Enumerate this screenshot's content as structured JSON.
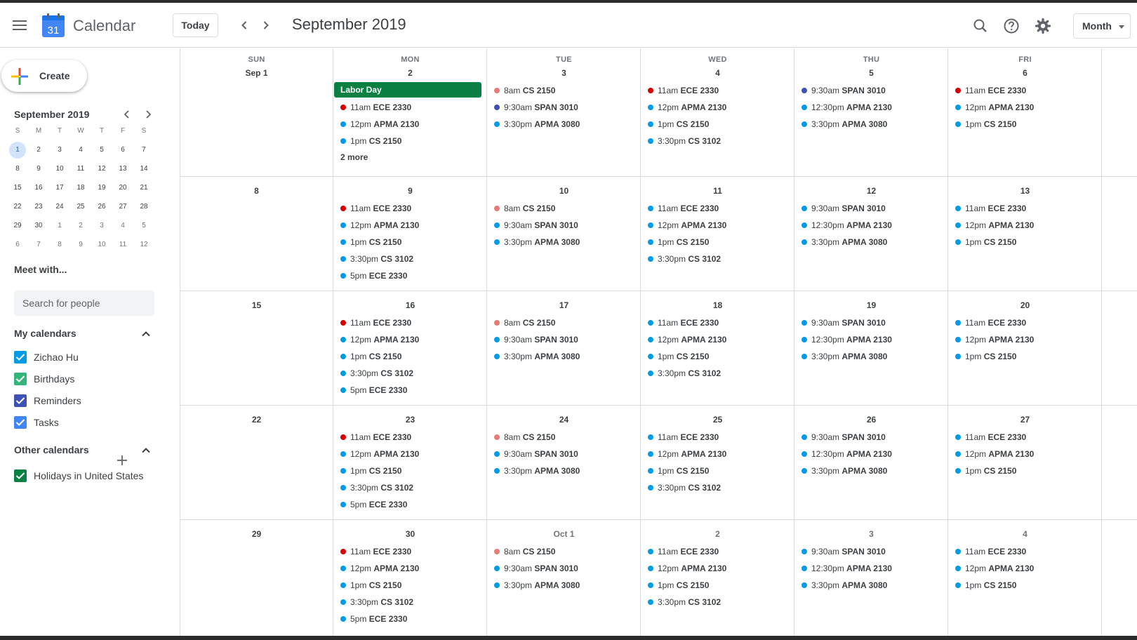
{
  "app": {
    "name": "Calendar",
    "logo_number": "31"
  },
  "header": {
    "today_label": "Today",
    "month_title": "September 2019",
    "view_label": "Month"
  },
  "sidebar": {
    "create_label": "Create",
    "mini_title": "September 2019",
    "mini_dow": [
      "S",
      "M",
      "T",
      "W",
      "T",
      "F",
      "S"
    ],
    "mini_days": [
      [
        "1",
        "2",
        "3",
        "4",
        "5",
        "6",
        "7"
      ],
      [
        "8",
        "9",
        "10",
        "11",
        "12",
        "13",
        "14"
      ],
      [
        "15",
        "16",
        "17",
        "18",
        "19",
        "20",
        "21"
      ],
      [
        "22",
        "23",
        "24",
        "25",
        "26",
        "27",
        "28"
      ],
      [
        "29",
        "30",
        "1",
        "2",
        "3",
        "4",
        "5"
      ],
      [
        "6",
        "7",
        "8",
        "9",
        "10",
        "11",
        "12"
      ]
    ],
    "meet_title": "Meet with...",
    "search_placeholder": "Search for people",
    "my_calendars_title": "My calendars",
    "my_calendars": [
      {
        "name": "Zichao Hu",
        "color": "#039be5"
      },
      {
        "name": "Birthdays",
        "color": "#33b679"
      },
      {
        "name": "Reminders",
        "color": "#3f51b5"
      },
      {
        "name": "Tasks",
        "color": "#4285f4"
      }
    ],
    "other_calendars_title": "Other calendars",
    "other_calendars": [
      {
        "name": "Holidays in United States",
        "color": "#0b8043"
      }
    ]
  },
  "colors": {
    "red": "#d50000",
    "blue": "#039be5",
    "indigo": "#3f51b5",
    "salmon": "#e67c73",
    "green": "#0b8043"
  },
  "month": {
    "dow": [
      "SUN",
      "MON",
      "TUE",
      "WED",
      "THU",
      "FRI"
    ],
    "weeks": [
      {
        "days": [
          {
            "date": "Sep 1",
            "events": []
          },
          {
            "date": "2",
            "allday": "Labor Day",
            "more": "2 more",
            "events": [
              {
                "time": "11am",
                "title": "ECE 2330",
                "color": "red"
              },
              {
                "time": "12pm",
                "title": "APMA 2130",
                "color": "blue"
              },
              {
                "time": "1pm",
                "title": "CS 2150",
                "color": "blue"
              }
            ]
          },
          {
            "date": "3",
            "events": [
              {
                "time": "8am",
                "title": "CS 2150",
                "color": "salmon"
              },
              {
                "time": "9:30am",
                "title": "SPAN 3010",
                "color": "indigo"
              },
              {
                "time": "3:30pm",
                "title": "APMA 3080",
                "color": "blue"
              }
            ]
          },
          {
            "date": "4",
            "events": [
              {
                "time": "11am",
                "title": "ECE 2330",
                "color": "red"
              },
              {
                "time": "12pm",
                "title": "APMA 2130",
                "color": "blue"
              },
              {
                "time": "1pm",
                "title": "CS 2150",
                "color": "blue"
              },
              {
                "time": "3:30pm",
                "title": "CS 3102",
                "color": "blue"
              }
            ]
          },
          {
            "date": "5",
            "events": [
              {
                "time": "9:30am",
                "title": "SPAN 3010",
                "color": "indigo"
              },
              {
                "time": "12:30pm",
                "title": "APMA 2130",
                "color": "blue"
              },
              {
                "time": "3:30pm",
                "title": "APMA 3080",
                "color": "blue"
              }
            ]
          },
          {
            "date": "6",
            "events": [
              {
                "time": "11am",
                "title": "ECE 2330",
                "color": "red"
              },
              {
                "time": "12pm",
                "title": "APMA 2130",
                "color": "blue"
              },
              {
                "time": "1pm",
                "title": "CS 2150",
                "color": "blue"
              }
            ]
          }
        ]
      },
      {
        "days": [
          {
            "date": "8",
            "events": []
          },
          {
            "date": "9",
            "events": [
              {
                "time": "11am",
                "title": "ECE 2330",
                "color": "red"
              },
              {
                "time": "12pm",
                "title": "APMA 2130",
                "color": "blue"
              },
              {
                "time": "1pm",
                "title": "CS 2150",
                "color": "blue"
              },
              {
                "time": "3:30pm",
                "title": "CS 3102",
                "color": "blue"
              },
              {
                "time": "5pm",
                "title": "ECE 2330",
                "color": "blue"
              }
            ]
          },
          {
            "date": "10",
            "events": [
              {
                "time": "8am",
                "title": "CS 2150",
                "color": "salmon"
              },
              {
                "time": "9:30am",
                "title": "SPAN 3010",
                "color": "blue"
              },
              {
                "time": "3:30pm",
                "title": "APMA 3080",
                "color": "blue"
              }
            ]
          },
          {
            "date": "11",
            "events": [
              {
                "time": "11am",
                "title": "ECE 2330",
                "color": "blue"
              },
              {
                "time": "12pm",
                "title": "APMA 2130",
                "color": "blue"
              },
              {
                "time": "1pm",
                "title": "CS 2150",
                "color": "blue"
              },
              {
                "time": "3:30pm",
                "title": "CS 3102",
                "color": "blue"
              }
            ]
          },
          {
            "date": "12",
            "events": [
              {
                "time": "9:30am",
                "title": "SPAN 3010",
                "color": "blue"
              },
              {
                "time": "12:30pm",
                "title": "APMA 2130",
                "color": "blue"
              },
              {
                "time": "3:30pm",
                "title": "APMA 3080",
                "color": "blue"
              }
            ]
          },
          {
            "date": "13",
            "events": [
              {
                "time": "11am",
                "title": "ECE 2330",
                "color": "blue"
              },
              {
                "time": "12pm",
                "title": "APMA 2130",
                "color": "blue"
              },
              {
                "time": "1pm",
                "title": "CS 2150",
                "color": "blue"
              }
            ]
          }
        ]
      },
      {
        "days": [
          {
            "date": "15",
            "events": []
          },
          {
            "date": "16",
            "events": [
              {
                "time": "11am",
                "title": "ECE 2330",
                "color": "red"
              },
              {
                "time": "12pm",
                "title": "APMA 2130",
                "color": "blue"
              },
              {
                "time": "1pm",
                "title": "CS 2150",
                "color": "blue"
              },
              {
                "time": "3:30pm",
                "title": "CS 3102",
                "color": "blue"
              },
              {
                "time": "5pm",
                "title": "ECE 2330",
                "color": "blue"
              }
            ]
          },
          {
            "date": "17",
            "events": [
              {
                "time": "8am",
                "title": "CS 2150",
                "color": "salmon"
              },
              {
                "time": "9:30am",
                "title": "SPAN 3010",
                "color": "blue"
              },
              {
                "time": "3:30pm",
                "title": "APMA 3080",
                "color": "blue"
              }
            ]
          },
          {
            "date": "18",
            "events": [
              {
                "time": "11am",
                "title": "ECE 2330",
                "color": "blue"
              },
              {
                "time": "12pm",
                "title": "APMA 2130",
                "color": "blue"
              },
              {
                "time": "1pm",
                "title": "CS 2150",
                "color": "blue"
              },
              {
                "time": "3:30pm",
                "title": "CS 3102",
                "color": "blue"
              }
            ]
          },
          {
            "date": "19",
            "events": [
              {
                "time": "9:30am",
                "title": "SPAN 3010",
                "color": "blue"
              },
              {
                "time": "12:30pm",
                "title": "APMA 2130",
                "color": "blue"
              },
              {
                "time": "3:30pm",
                "title": "APMA 3080",
                "color": "blue"
              }
            ]
          },
          {
            "date": "20",
            "events": [
              {
                "time": "11am",
                "title": "ECE 2330",
                "color": "blue"
              },
              {
                "time": "12pm",
                "title": "APMA 2130",
                "color": "blue"
              },
              {
                "time": "1pm",
                "title": "CS 2150",
                "color": "blue"
              }
            ]
          }
        ]
      },
      {
        "days": [
          {
            "date": "22",
            "events": []
          },
          {
            "date": "23",
            "events": [
              {
                "time": "11am",
                "title": "ECE 2330",
                "color": "red"
              },
              {
                "time": "12pm",
                "title": "APMA 2130",
                "color": "blue"
              },
              {
                "time": "1pm",
                "title": "CS 2150",
                "color": "blue"
              },
              {
                "time": "3:30pm",
                "title": "CS 3102",
                "color": "blue"
              },
              {
                "time": "5pm",
                "title": "ECE 2330",
                "color": "blue"
              }
            ]
          },
          {
            "date": "24",
            "events": [
              {
                "time": "8am",
                "title": "CS 2150",
                "color": "salmon"
              },
              {
                "time": "9:30am",
                "title": "SPAN 3010",
                "color": "blue"
              },
              {
                "time": "3:30pm",
                "title": "APMA 3080",
                "color": "blue"
              }
            ]
          },
          {
            "date": "25",
            "events": [
              {
                "time": "11am",
                "title": "ECE 2330",
                "color": "blue"
              },
              {
                "time": "12pm",
                "title": "APMA 2130",
                "color": "blue"
              },
              {
                "time": "1pm",
                "title": "CS 2150",
                "color": "blue"
              },
              {
                "time": "3:30pm",
                "title": "CS 3102",
                "color": "blue"
              }
            ]
          },
          {
            "date": "26",
            "events": [
              {
                "time": "9:30am",
                "title": "SPAN 3010",
                "color": "blue"
              },
              {
                "time": "12:30pm",
                "title": "APMA 2130",
                "color": "blue"
              },
              {
                "time": "3:30pm",
                "title": "APMA 3080",
                "color": "blue"
              }
            ]
          },
          {
            "date": "27",
            "events": [
              {
                "time": "11am",
                "title": "ECE 2330",
                "color": "blue"
              },
              {
                "time": "12pm",
                "title": "APMA 2130",
                "color": "blue"
              },
              {
                "time": "1pm",
                "title": "CS 2150",
                "color": "blue"
              }
            ]
          }
        ]
      },
      {
        "days": [
          {
            "date": "29",
            "events": []
          },
          {
            "date": "30",
            "events": [
              {
                "time": "11am",
                "title": "ECE 2330",
                "color": "red"
              },
              {
                "time": "12pm",
                "title": "APMA 2130",
                "color": "blue"
              },
              {
                "time": "1pm",
                "title": "CS 2150",
                "color": "blue"
              },
              {
                "time": "3:30pm",
                "title": "CS 3102",
                "color": "blue"
              },
              {
                "time": "5pm",
                "title": "ECE 2330",
                "color": "blue"
              }
            ]
          },
          {
            "date": "Oct 1",
            "faded": true,
            "events": [
              {
                "time": "8am",
                "title": "CS 2150",
                "color": "salmon"
              },
              {
                "time": "9:30am",
                "title": "SPAN 3010",
                "color": "blue"
              },
              {
                "time": "3:30pm",
                "title": "APMA 3080",
                "color": "blue"
              }
            ]
          },
          {
            "date": "2",
            "faded": true,
            "events": [
              {
                "time": "11am",
                "title": "ECE 2330",
                "color": "blue"
              },
              {
                "time": "12pm",
                "title": "APMA 2130",
                "color": "blue"
              },
              {
                "time": "1pm",
                "title": "CS 2150",
                "color": "blue"
              },
              {
                "time": "3:30pm",
                "title": "CS 3102",
                "color": "blue"
              }
            ]
          },
          {
            "date": "3",
            "faded": true,
            "events": [
              {
                "time": "9:30am",
                "title": "SPAN 3010",
                "color": "blue"
              },
              {
                "time": "12:30pm",
                "title": "APMA 2130",
                "color": "blue"
              },
              {
                "time": "3:30pm",
                "title": "APMA 3080",
                "color": "blue"
              }
            ]
          },
          {
            "date": "4",
            "faded": true,
            "events": [
              {
                "time": "11am",
                "title": "ECE 2330",
                "color": "blue"
              },
              {
                "time": "12pm",
                "title": "APMA 2130",
                "color": "blue"
              },
              {
                "time": "1pm",
                "title": "CS 2150",
                "color": "blue"
              }
            ]
          }
        ]
      }
    ]
  }
}
